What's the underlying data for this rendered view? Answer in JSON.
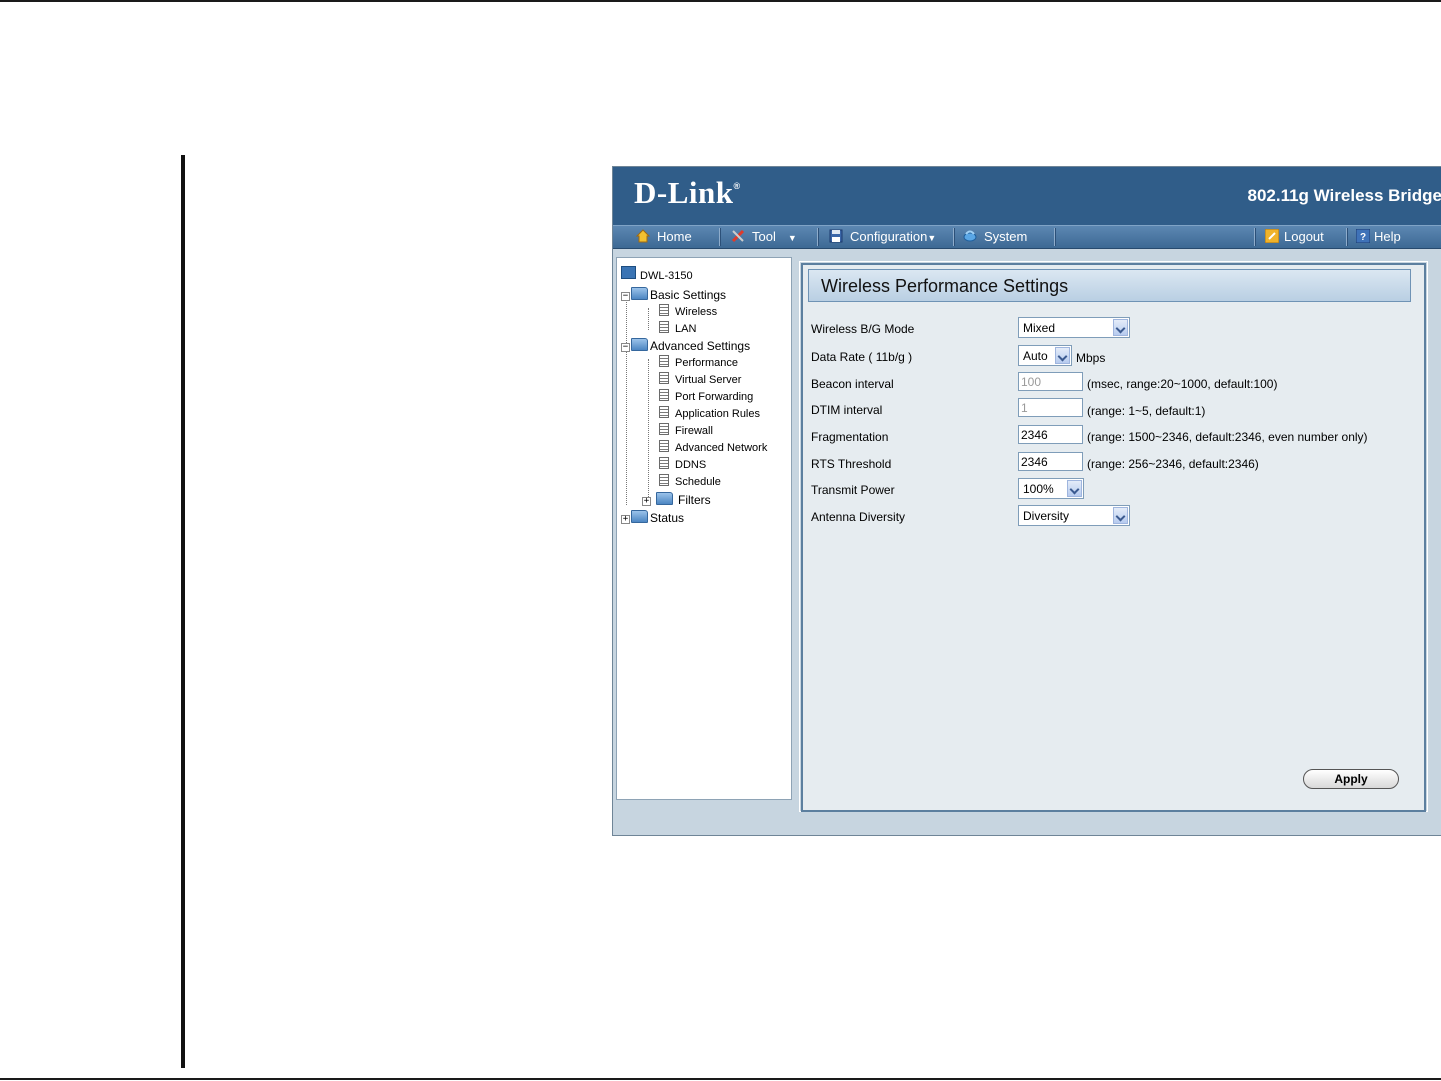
{
  "header": {
    "logo": "D-Link",
    "logo_mark": "®",
    "product": "802.11g Wireless Bridge"
  },
  "menu": {
    "home": "Home",
    "tool": "Tool",
    "configuration": "Configuration",
    "system": "System",
    "logout": "Logout",
    "help": "Help"
  },
  "tree": {
    "root": "DWL-3150",
    "basic_settings": "Basic Settings",
    "wireless": "Wireless",
    "lan": "LAN",
    "advanced_settings": "Advanced Settings",
    "performance": "Performance",
    "virtual_server": "Virtual Server",
    "port_forwarding": "Port Forwarding",
    "application_rules": "Application Rules",
    "firewall": "Firewall",
    "advanced_network": "Advanced Network",
    "ddns": "DDNS",
    "schedule": "Schedule",
    "filters": "Filters",
    "status": "Status"
  },
  "panel": {
    "title": "Wireless Performance Settings",
    "wireless_mode": {
      "label": "Wireless B/G Mode",
      "value": "Mixed"
    },
    "data_rate": {
      "label": "Data Rate ( 11b/g )",
      "value": "Auto",
      "unit": "Mbps"
    },
    "beacon": {
      "label": "Beacon interval",
      "value": "100",
      "hint": "(msec, range:20~1000, default:100)"
    },
    "dtim": {
      "label": "DTIM interval",
      "value": "1",
      "hint": "(range: 1~5, default:1)"
    },
    "fragmentation": {
      "label": "Fragmentation",
      "value": "2346",
      "hint": "(range: 1500~2346, default:2346, even number only)"
    },
    "rts": {
      "label": "RTS Threshold",
      "value": "2346",
      "hint": "(range: 256~2346, default:2346)"
    },
    "transmit_power": {
      "label": "Transmit Power",
      "value": "100%"
    },
    "antenna": {
      "label": "Antenna Diversity",
      "value": "Diversity"
    },
    "apply": "Apply"
  },
  "colors": {
    "header": "#305d89",
    "menubar": "#4a77a3",
    "panel_bg": "#e6ecf0",
    "app_bg": "#c7d5e0"
  }
}
